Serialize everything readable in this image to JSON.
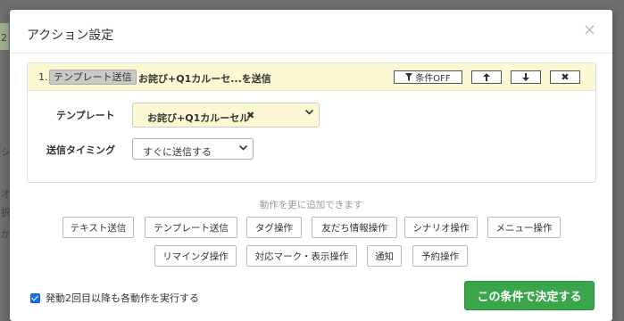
{
  "background": {
    "frag1": "2",
    "frag2": "シ",
    "frag3": "オフ",
    "frag4": "択",
    "frag5": "か"
  },
  "modal": {
    "title": "アクション設定",
    "close": "×"
  },
  "action": {
    "number": "1.",
    "type_badge": "テンプレート送信",
    "name": "お詫び+Q1カルーセ...を送信",
    "buttons": {
      "condition": "条件OFF",
      "up": "↑",
      "down": "↓",
      "delete": "✖"
    },
    "template_label": "テンプレート",
    "template_value": "お詫び+Q1カルーセル",
    "timing_label": "送信タイミング",
    "timing_value": "すぐに送信する"
  },
  "add_section": {
    "caption": "動作を更に追加できます",
    "options": [
      "テキスト送信",
      "テンプレート送信",
      "タグ操作",
      "友だち情報操作",
      "シナリオ操作",
      "メニュー操作",
      "リマインダ操作",
      "対応マーク・表示操作",
      "通知",
      "予約操作"
    ]
  },
  "footer": {
    "repeat_label": "発動2回目以降も各動作を実行する",
    "submit": "この条件で決定する"
  },
  "colors": {
    "accent_green": "#3aa54a",
    "highlight_yellow": "#fcf8d4",
    "checkbox_blue": "#1a73e8"
  }
}
